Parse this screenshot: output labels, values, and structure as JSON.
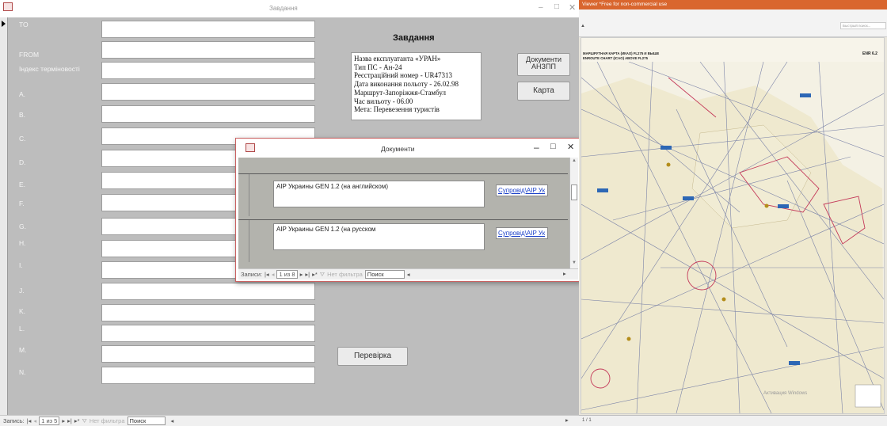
{
  "main_window": {
    "title": "Завдання",
    "controls": {
      "minimize": "–",
      "maximize": "□",
      "close": "✕"
    }
  },
  "form": {
    "fields": [
      {
        "label": "TO",
        "value": ""
      },
      {
        "label": "FROM",
        "value": ""
      },
      {
        "label": "Індекс терміновості",
        "value": ""
      },
      {
        "label": "A.",
        "value": ""
      },
      {
        "label": "B.",
        "value": ""
      },
      {
        "label": "C.",
        "value": ""
      },
      {
        "label": "D.",
        "value": ""
      },
      {
        "label": "E.",
        "value": ""
      },
      {
        "label": "F.",
        "value": ""
      },
      {
        "label": "G.",
        "value": ""
      },
      {
        "label": "H.",
        "value": ""
      },
      {
        "label": "I.",
        "value": ""
      },
      {
        "label": "J.",
        "value": ""
      },
      {
        "label": "K.",
        "value": ""
      },
      {
        "label": "L.",
        "value": ""
      },
      {
        "label": "M.",
        "value": ""
      },
      {
        "label": "N.",
        "value": ""
      }
    ],
    "task_title": "Завдання",
    "task_lines": [
      "Назва експлуатанта «УРАН»",
      "Тип ПС - Ан-24",
      "Реєстраційний номер - UR47313",
      "Дата виконання польоту - 26.02.98",
      "Маршрут-Запоріжжя-Стамбул",
      "Час вильоту - 06.00",
      "Мета: Перевезення туристів"
    ],
    "docs_button_line1": "Документи",
    "docs_button_line2": "АНЗПП",
    "map_button": "Карта",
    "check_button": "Перевірка"
  },
  "main_nav": {
    "label": "Запись:",
    "position": "1 из 5",
    "filter": "Нет фильтра",
    "search": "Поиск"
  },
  "doc_window": {
    "title": "Документи",
    "controls": {
      "minimize": "–",
      "maximize": "□",
      "close": "✕"
    },
    "records": [
      {
        "text": "AIP Украины GEN 1.2 (на английском)",
        "link": "Супровід\\AIP Ук"
      },
      {
        "text": "AIP Украины GEN 1.2 (на русском",
        "link": "Супровід\\AIP Ук"
      }
    ],
    "nav": {
      "label": "Записи:",
      "position": "1 из 8",
      "filter": "Нет фильтра",
      "search": "Поиск"
    }
  },
  "viewer": {
    "banner": "Viewer *Free for non-commercial use",
    "search_placeholder": "Быстрый поиск...",
    "chart_title_ua": "МАРШРУТНАЯ КАРТА (ИКАО) FL275 И ВЫШЕ",
    "chart_title_en": "ENROUTE CHART (ICAO) ABOVE FL275",
    "chart_code": "ENR 6.2",
    "watermark": "Активация Windows",
    "status_page": "1 / 1"
  }
}
